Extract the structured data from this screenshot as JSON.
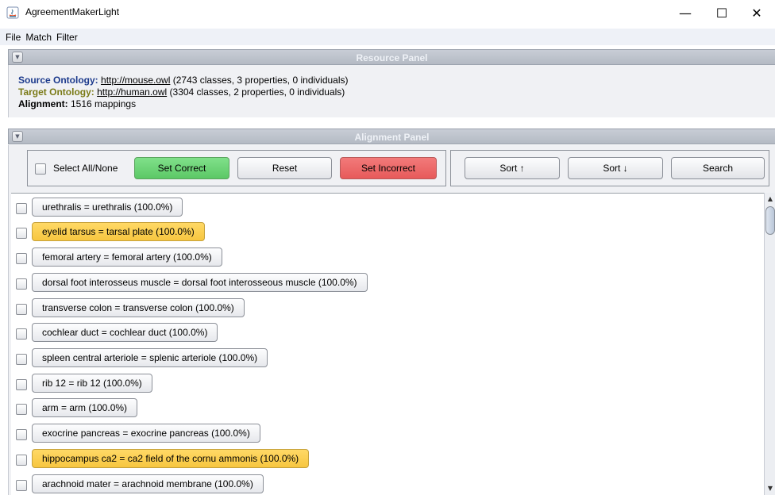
{
  "window": {
    "title": "AgreementMakerLight",
    "minimize_glyph": "—",
    "maximize_glyph": "☐",
    "close_glyph": "✕"
  },
  "menu": [
    "File",
    "Match",
    "Filter"
  ],
  "resource_panel": {
    "title": "Resource Panel",
    "collapse_glyph": "▼",
    "source_label": "Source Ontology:",
    "source_link": "http://mouse.owl",
    "source_info": " (2743 classes, 3 properties, 0 individuals)",
    "target_label": "Target Ontology:",
    "target_link": "http://human.owl",
    "target_info": " (3304 classes, 2 properties, 0 individuals)",
    "alignment_label": "Alignment:",
    "alignment_value": " 1516 mappings"
  },
  "alignment_panel": {
    "title": "Alignment Panel",
    "collapse_glyph": "▼",
    "select_all_label": "Select All/None",
    "set_correct_label": "Set Correct",
    "reset_label": "Reset",
    "set_incorrect_label": "Set Incorrect",
    "sort_up_label": "Sort ↑",
    "sort_down_label": "Sort ↓",
    "search_label": "Search"
  },
  "mappings": [
    {
      "text": "urethralis = urethralis (100.0%)",
      "highlight": false
    },
    {
      "text": "eyelid tarsus = tarsal plate (100.0%)",
      "highlight": true
    },
    {
      "text": "femoral artery = femoral artery (100.0%)",
      "highlight": false
    },
    {
      "text": "dorsal foot interosseus muscle = dorsal foot interosseous muscle (100.0%)",
      "highlight": false
    },
    {
      "text": "transverse colon = transverse colon (100.0%)",
      "highlight": false
    },
    {
      "text": "cochlear duct = cochlear duct (100.0%)",
      "highlight": false
    },
    {
      "text": "spleen central arteriole = splenic arteriole (100.0%)",
      "highlight": false
    },
    {
      "text": "rib 12 = rib 12 (100.0%)",
      "highlight": false
    },
    {
      "text": "arm = arm (100.0%)",
      "highlight": false
    },
    {
      "text": "exocrine pancreas = exocrine pancreas (100.0%)",
      "highlight": false
    },
    {
      "text": "hippocampus ca2 = ca2 field of the cornu ammonis (100.0%)",
      "highlight": true
    },
    {
      "text": "arachnoid mater = arachnoid membrane (100.0%)",
      "highlight": false
    }
  ],
  "colors": {
    "highlight": "#f7c640",
    "set_correct": "#5cc866",
    "set_incorrect": "#e75a5a",
    "source_label": "#1c3a8c",
    "target_label": "#7a7a16"
  }
}
